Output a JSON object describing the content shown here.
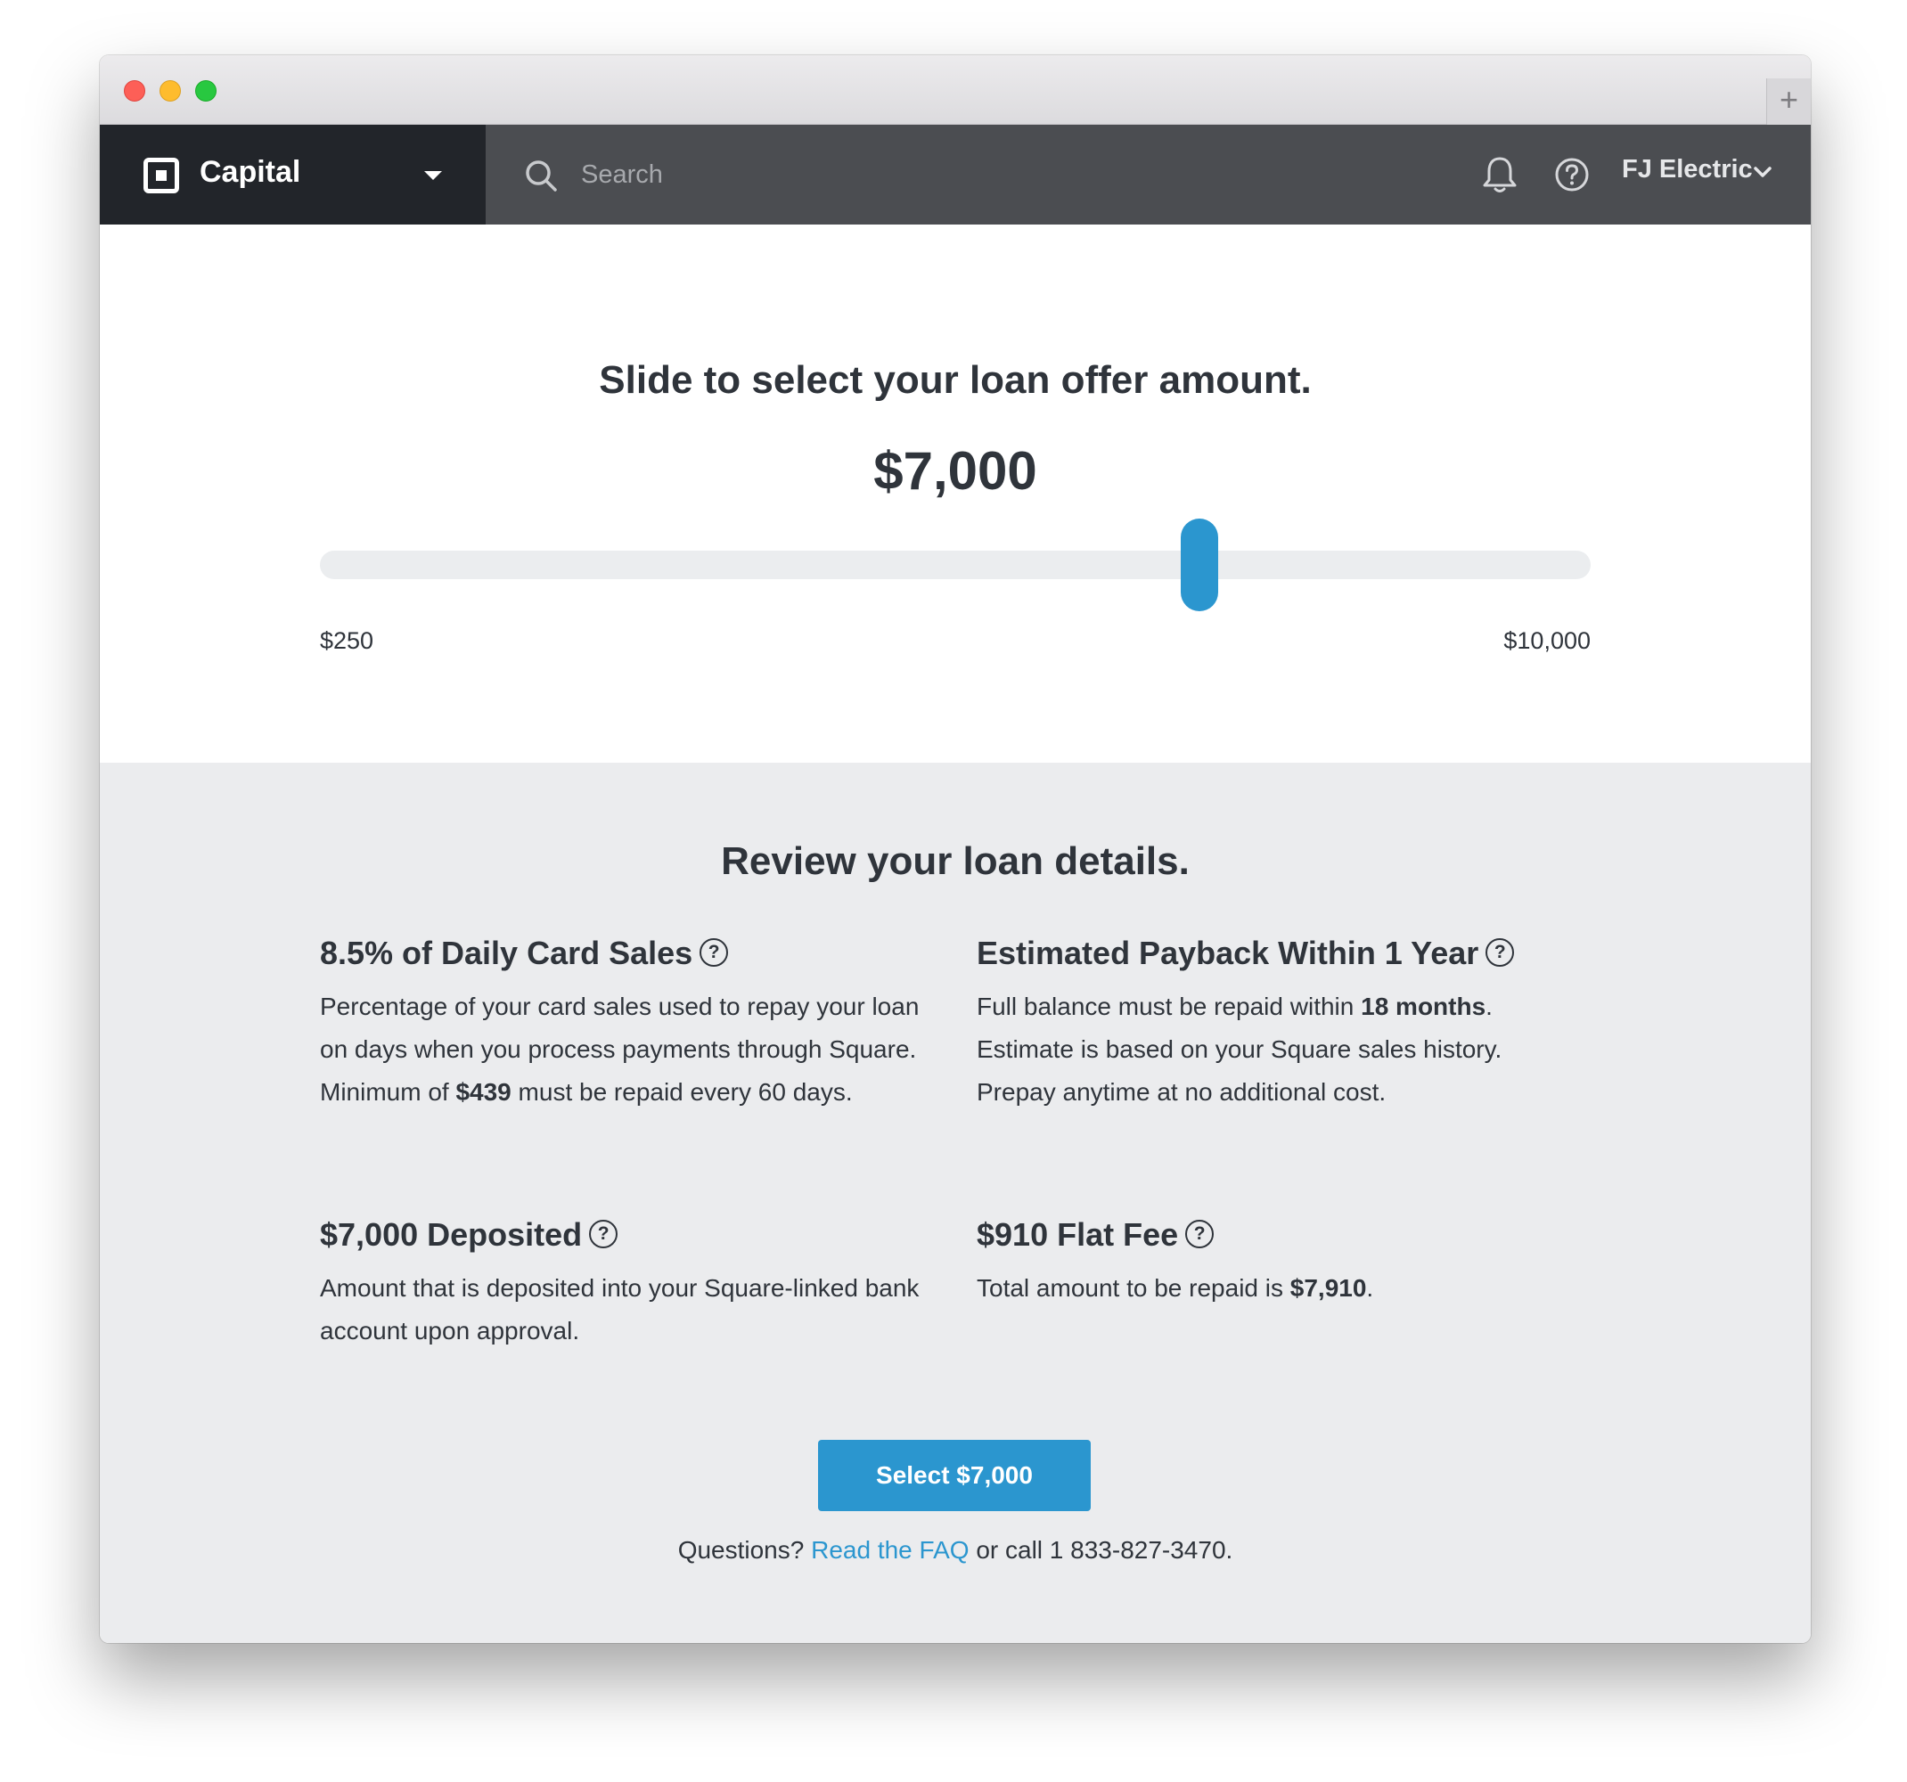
{
  "app": {
    "name": "Capital",
    "search_placeholder": "Search",
    "account": "FJ Electric",
    "newtab_symbol": "+"
  },
  "slider": {
    "title": "Slide to select your loan offer amount.",
    "amount": "$7,000",
    "min_label": "$250",
    "max_label": "$10,000",
    "min_value": 250,
    "max_value": 10000,
    "value": 7000
  },
  "details": {
    "title": "Review your loan details.",
    "cards": [
      {
        "heading": "8.5% of Daily Card Sales",
        "text_before": "Percentage of your card sales used to repay your loan on days when you process payments through Square. Minimum of ",
        "text_bold": "$439",
        "text_after": " must be repaid every 60 days."
      },
      {
        "heading": "Estimated Payback Within 1 Year",
        "text_before": "Full balance must be repaid within ",
        "text_bold": "18 months",
        "text_after": ". Estimate is based on your Square sales history. Prepay anytime at no additional cost."
      },
      {
        "heading": "$7,000 Deposited",
        "text_before": "Amount that is deposited into your Square-linked bank account upon approval.",
        "text_bold": "",
        "text_after": ""
      },
      {
        "heading": "$910 Flat Fee",
        "text_before": "Total amount to be repaid is ",
        "text_bold": "$7,910",
        "text_after": "."
      }
    ],
    "help_glyph": "?"
  },
  "cta": {
    "select_label": "Select $7,000",
    "questions": "Questions?",
    "faq_link": "Read the FAQ",
    "call_text": "or call 1 833-827-3470."
  },
  "colors": {
    "accent": "#2b96cf",
    "header_dark": "#22252a",
    "header": "#4b4d51",
    "details_bg": "#ebecee"
  }
}
